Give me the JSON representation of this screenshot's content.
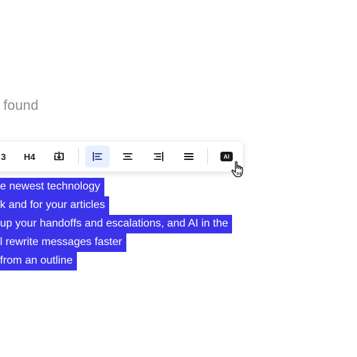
{
  "header": {
    "text": "found"
  },
  "toolbar": {
    "h3_label": "3",
    "h4_label": "H4",
    "ai_label": "AI"
  },
  "selection": {
    "lines": [
      "e newest technology",
      "k and for your articles",
      "up your handoffs and escalations, and AI in the",
      "l rewrite messages faster",
      "from an outline"
    ],
    "highlight_color": "#3b33e9"
  },
  "icons": {
    "collapse": "collapsible-block-icon",
    "align_left": "align-left-icon",
    "align_center": "align-center-icon",
    "align_right": "align-right-icon",
    "justify": "justify-icon",
    "cursor": "hand-pointer-cursor-icon"
  }
}
